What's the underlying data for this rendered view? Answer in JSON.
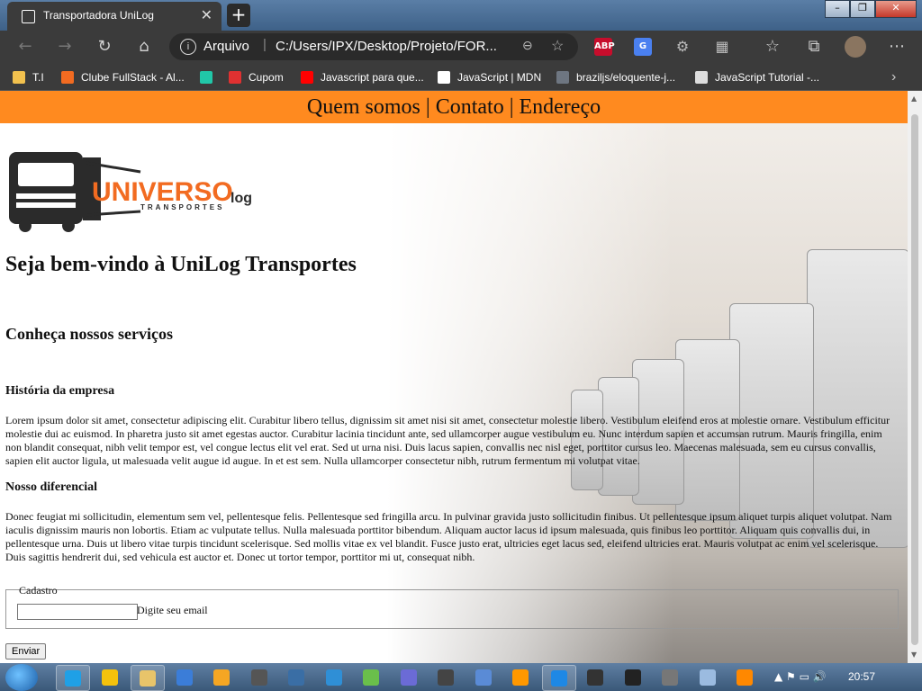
{
  "browser": {
    "tab_title": "Transportadora UniLog",
    "tab_close": "✕",
    "new_tab": "+",
    "address_label": "Arquivo",
    "address_url": "C:/Users/IPX/Desktop/Projeto/FOR...",
    "window_buttons": [
      "–",
      "❐",
      "✕"
    ],
    "extensions": [
      {
        "name": "abp-icon",
        "label": "ABP",
        "color": "#c70d2c"
      },
      {
        "name": "translate-icon",
        "label": "G",
        "color": "#4a80f0"
      },
      {
        "name": "gear-icon",
        "label": "⚙",
        "color": "#3b3b3b"
      },
      {
        "name": "extension-icon",
        "label": "▦",
        "color": "#3b3b3b"
      }
    ]
  },
  "bookmarks": [
    {
      "label": "T.I",
      "icon_color": "#f2c14e"
    },
    {
      "label": "Clube FullStack - Al...",
      "icon_color": "#f26b21"
    },
    {
      "label": "",
      "icon_color": "#21c7a8"
    },
    {
      "label": "Cupom",
      "icon_color": "#e03131"
    },
    {
      "label": "Javascript para que...",
      "icon_color": "#ff0000"
    },
    {
      "label": "JavaScript | MDN",
      "icon_color": "#ffffff"
    },
    {
      "label": "braziljs/eloquente-j...",
      "icon_color": "#6e7681"
    },
    {
      "label": "JavaScript Tutorial -...",
      "icon_color": "#dddddd"
    }
  ],
  "page": {
    "nav_text": "Quem somos | Contato | Endereço",
    "logo_word": "UNIVERSO",
    "logo_suffix": "log",
    "logo_sub": "TRANSPORTES",
    "h1": "Seja bem-vindo à UniLog Transportes",
    "h2": "Conheça nossos serviços",
    "h3_history": "História da empresa",
    "p_history": "Lorem ipsum dolor sit amet, consectetur adipiscing elit. Curabitur libero tellus, dignissim sit amet nisi sit amet, consectetur molestie libero. Vestibulum eleifend eros at molestie ornare. Vestibulum efficitur molestie dui ac euismod. In pharetra justo sit amet egestas auctor. Curabitur lacinia tincidunt ante, sed ullamcorper augue vestibulum eu. Nunc interdum sapien et accumsan rutrum. Mauris fringilla, enim non blandit consequat, nibh velit tempor est, vel congue lectus elit vel erat. Sed ut urna nisi. Duis lacus sapien, convallis nec nisl eget, porttitor cursus leo. Maecenas malesuada, sem eu cursus convallis, sapien elit auctor ligula, ut malesuada velit augue id augue. In et est sem. Nulla ullamcorper consectetur nibh, rutrum fermentum mi volutpat vitae.",
    "h3_diff": "Nosso diferencial",
    "p_diff": "Donec feugiat mi sollicitudin, elementum sem vel, pellentesque felis. Pellentesque sed fringilla arcu. In pulvinar gravida justo sollicitudin finibus. Ut pellentesque ipsum aliquet turpis aliquet volutpat. Nam iaculis dignissim mauris non lobortis. Etiam ac vulputate tellus. Nulla malesuada porttitor bibendum. Aliquam auctor lacus id ipsum malesuada, quis finibus leo porttitor. Aliquam quis convallis dui, in pellentesque urna. Duis ut libero vitae turpis tincidunt scelerisque. Sed mollis vitae ex vel blandit. Fusce justo erat, ultricies eget lacus sed, eleifend ultricies erat. Mauris volutpat ac enim vel scelerisque. Duis sagittis hendrerit dui, sed vehicula est auctor et. Donec ut tortor tempor, porttitor mi ut, consequat nibh.",
    "form_legend": "Cadastro",
    "email_label": "Digite seu email",
    "email_value": "",
    "submit_label": "Enviar"
  },
  "colors": {
    "nav_bg": "#ff8a1f",
    "logo_orange": "#f26b21",
    "logo_dark": "#2b2b2b"
  },
  "taskbar": {
    "clock": "20:57",
    "apps": [
      {
        "name": "edge-icon",
        "color": "#1fa0e6",
        "active": true
      },
      {
        "name": "chrome-icon",
        "color": "#f4c20d",
        "active": false
      },
      {
        "name": "explorer-icon",
        "color": "#e8c46a",
        "active": true
      },
      {
        "name": "app-icon-4",
        "color": "#3b7dd8",
        "active": false
      },
      {
        "name": "media-icon",
        "color": "#f5a623",
        "active": false
      },
      {
        "name": "app-icon-6",
        "color": "#555555",
        "active": false
      },
      {
        "name": "app-icon-7",
        "color": "#3a6ea5",
        "active": false
      },
      {
        "name": "app-icon-8",
        "color": "#2f8fd6",
        "active": false
      },
      {
        "name": "app-icon-9",
        "color": "#6abf4b",
        "active": false
      },
      {
        "name": "app-icon-10",
        "color": "#6b6bd6",
        "active": false
      },
      {
        "name": "app-icon-11",
        "color": "#444444",
        "active": false
      },
      {
        "name": "app-icon-12",
        "color": "#5a8bd6",
        "active": false
      },
      {
        "name": "sublime-icon",
        "color": "#ff9800",
        "active": false
      },
      {
        "name": "vscode-icon",
        "color": "#1e88e5",
        "active": true
      },
      {
        "name": "app-icon-15",
        "color": "#333333",
        "active": false
      },
      {
        "name": "terminal-icon",
        "color": "#222222",
        "active": false
      },
      {
        "name": "gamepad-icon",
        "color": "#777777",
        "active": false
      },
      {
        "name": "keyboard-icon",
        "color": "#9bbbe0",
        "active": false
      },
      {
        "name": "vlc-icon",
        "color": "#ff8800",
        "active": false
      }
    ]
  }
}
